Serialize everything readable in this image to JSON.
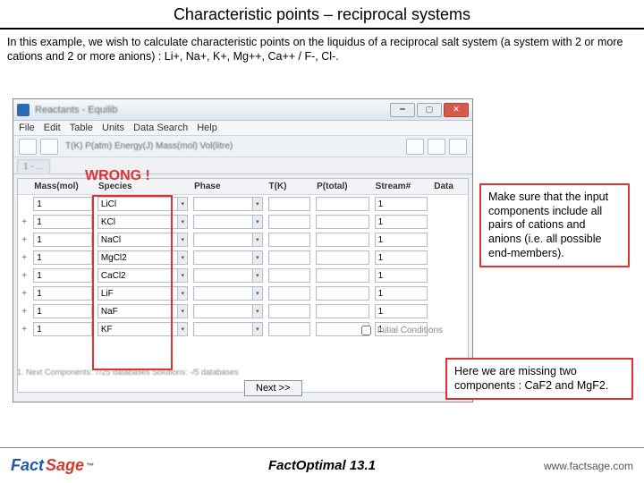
{
  "slide": {
    "title": "Characteristic points – reciprocal systems",
    "intro": "In this example, we wish to calculate characteristic points on the liquidus of a reciprocal salt system (a system with 2 or more cations and 2 or more anions) : Li+, Na+, K+, Mg++, Ca++  / F-, Cl-."
  },
  "app": {
    "window_title": "Reactants - Equilib",
    "menu": [
      "File",
      "Edit",
      "Table",
      "Units",
      "Data Search",
      "Help"
    ],
    "tool_caption": "T(K)  P(atm)  Energy(J)  Mass(mol)  Vol(litre)",
    "tab1": "1 - ...",
    "next": "Next >>",
    "status": "1. Next      Components: 7/25 databases      Solutions: -/5 databases",
    "init_conditions_label": "Initial Conditions"
  },
  "grid": {
    "headers": {
      "mass": "Mass(mol)",
      "species": "Species",
      "phase": "Phase",
      "tk": "T(K)",
      "ptotal": "P(total)",
      "stream": "Stream#",
      "data": "Data"
    },
    "rows": [
      {
        "plus": "",
        "mass": "1",
        "species": "LiCl",
        "stream": "1"
      },
      {
        "plus": "+",
        "mass": "1",
        "species": "KCl",
        "stream": "1"
      },
      {
        "plus": "+",
        "mass": "1",
        "species": "NaCl",
        "stream": "1"
      },
      {
        "plus": "+",
        "mass": "1",
        "species": "MgCl2",
        "stream": "1"
      },
      {
        "plus": "+",
        "mass": "1",
        "species": "CaCl2",
        "stream": "1"
      },
      {
        "plus": "+",
        "mass": "1",
        "species": "LiF",
        "stream": "1"
      },
      {
        "plus": "+",
        "mass": "1",
        "species": "NaF",
        "stream": "1"
      },
      {
        "plus": "+",
        "mass": "1",
        "species": "KF",
        "stream": "1"
      }
    ]
  },
  "annotations": {
    "wrong": "WRONG !",
    "tip1": "Make sure that the input components include all pairs of cations and anions (i.e. all possible end-members).",
    "tip2": "Here we are missing two components : CaF2 and MgF2."
  },
  "footer": {
    "logo_left": "Fact",
    "logo_right": "Sage",
    "center": "FactOptimal   13.1",
    "url": "www.factsage.com"
  }
}
